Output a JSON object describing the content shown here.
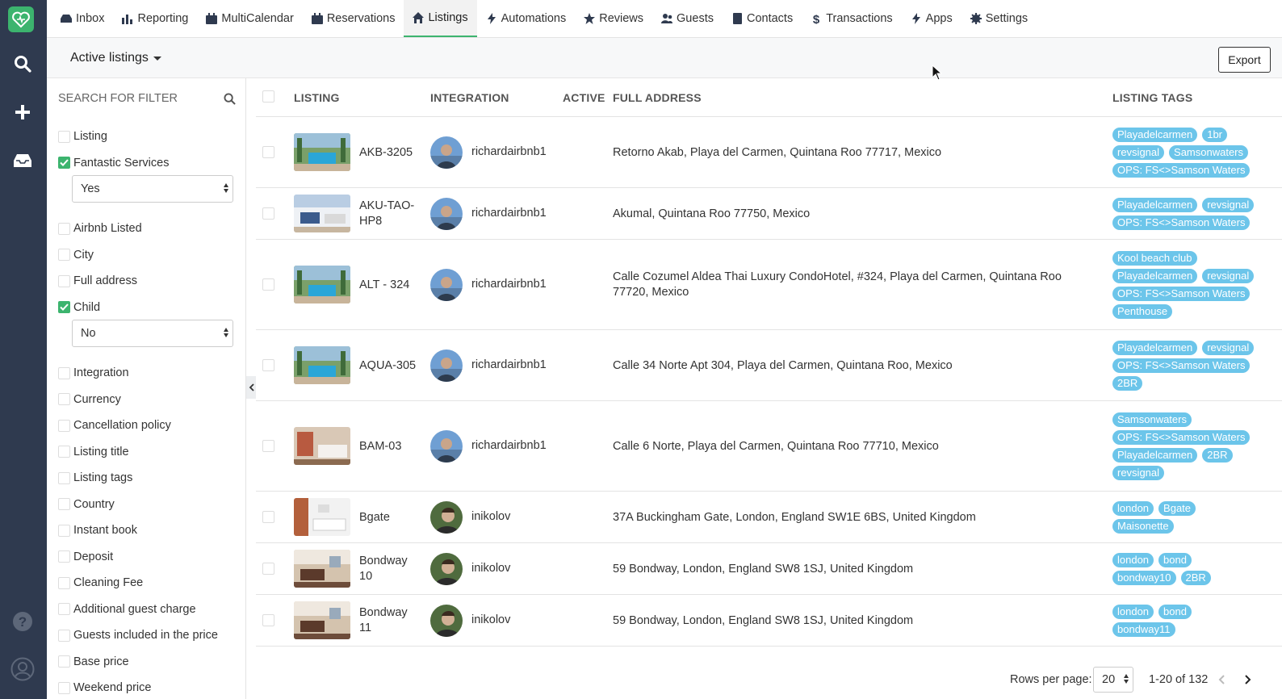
{
  "nav": {
    "items": [
      {
        "label": "Inbox",
        "icon": "inbox-icon"
      },
      {
        "label": "Reporting",
        "icon": "bar-chart-icon"
      },
      {
        "label": "MultiCalendar",
        "icon": "calendar-icon"
      },
      {
        "label": "Reservations",
        "icon": "calendar-check-icon"
      },
      {
        "label": "Listings",
        "icon": "home-icon",
        "active": true
      },
      {
        "label": "Automations",
        "icon": "bolt-icon"
      },
      {
        "label": "Reviews",
        "icon": "star-icon"
      },
      {
        "label": "Guests",
        "icon": "users-icon"
      },
      {
        "label": "Contacts",
        "icon": "address-book-icon"
      },
      {
        "label": "Transactions",
        "icon": "dollar-icon"
      },
      {
        "label": "Apps",
        "icon": "bolt-icon"
      },
      {
        "label": "Settings",
        "icon": "gear-icon"
      }
    ]
  },
  "header": {
    "view_label": "Active listings",
    "export_label": "Export"
  },
  "filters": {
    "search_placeholder": "SEARCH FOR FILTER",
    "items": [
      {
        "label": "Listing",
        "checked": false
      },
      {
        "label": "Fantastic Services",
        "checked": true,
        "select_value": "Yes"
      },
      {
        "label": "Airbnb Listed",
        "checked": false
      },
      {
        "label": "City",
        "checked": false
      },
      {
        "label": "Full address",
        "checked": false
      },
      {
        "label": "Child",
        "checked": true,
        "select_value": "No"
      },
      {
        "label": "Integration",
        "checked": false
      },
      {
        "label": "Currency",
        "checked": false
      },
      {
        "label": "Cancellation policy",
        "checked": false
      },
      {
        "label": "Listing title",
        "checked": false
      },
      {
        "label": "Listing tags",
        "checked": false
      },
      {
        "label": "Country",
        "checked": false
      },
      {
        "label": "Instant book",
        "checked": false
      },
      {
        "label": "Deposit",
        "checked": false
      },
      {
        "label": "Cleaning Fee",
        "checked": false
      },
      {
        "label": "Additional guest charge",
        "checked": false
      },
      {
        "label": "Guests included in the price",
        "checked": false
      },
      {
        "label": "Base price",
        "checked": false
      },
      {
        "label": "Weekend price",
        "checked": false
      }
    ]
  },
  "table": {
    "columns": {
      "listing": "LISTING",
      "integration": "INTEGRATION",
      "active": "ACTIVE",
      "address": "FULL ADDRESS",
      "tags": "LISTING TAGS"
    },
    "rows": [
      {
        "name": "AKB-3205",
        "integration": "richardairbnb1",
        "address": "Retorno Akab, Playa del Carmen, Quintana Roo 77717, Mexico",
        "tags": [
          "Playadelcarmen",
          "1br",
          "revsignal",
          "Samsonwaters",
          "OPS: FS<>Samson Waters"
        ],
        "thumb": "pool"
      },
      {
        "name": "AKU-TAO-HP8",
        "integration": "richardairbnb1",
        "address": "Akumal, Quintana Roo 77750, Mexico",
        "tags": [
          "Playadelcarmen",
          "revsignal",
          "OPS: FS<>Samson Waters"
        ],
        "thumb": "room"
      },
      {
        "name": "ALT - 324",
        "integration": "richardairbnb1",
        "address": "Calle Cozumel Aldea Thai Luxury CondoHotel, #324, Playa del Carmen, Quintana Roo 77720, Mexico",
        "tags": [
          "Kool beach club",
          "Playadelcarmen",
          "revsignal",
          "OPS: FS<>Samson Waters",
          "Penthouse"
        ],
        "thumb": "pool"
      },
      {
        "name": "AQUA-305",
        "integration": "richardairbnb1",
        "address": "Calle 34 Norte Apt 304, Playa del Carmen, Quintana Roo, Mexico",
        "tags": [
          "Playadelcarmen",
          "revsignal",
          "OPS: FS<>Samson Waters",
          "2BR"
        ],
        "thumb": "pool"
      },
      {
        "name": "BAM-03",
        "integration": "richardairbnb1",
        "address": "Calle 6 Norte, Playa del Carmen, Quintana Roo 77710, Mexico",
        "tags": [
          "Samsonwaters",
          "OPS: FS<>Samson Waters",
          "Playadelcarmen",
          "2BR",
          "revsignal"
        ],
        "thumb": "bedroom"
      },
      {
        "name": "Bgate",
        "integration": "inikolov",
        "address": "37A Buckingham Gate, London, England SW1E 6BS, United Kingdom",
        "tags": [
          "london",
          "Bgate",
          "Maisonette"
        ],
        "thumb": "kitchen"
      },
      {
        "name": "Bondway 10",
        "integration": "inikolov",
        "address": "59 Bondway, London, England SW8 1SJ, United Kingdom",
        "tags": [
          "london",
          "bond",
          "bondway10",
          "2BR"
        ],
        "thumb": "living"
      },
      {
        "name": "Bondway 11",
        "integration": "inikolov",
        "address": "59 Bondway, London, England SW8 1SJ, United Kingdom",
        "tags": [
          "london",
          "bond",
          "bondway11"
        ],
        "thumb": "living"
      }
    ]
  },
  "pager": {
    "rows_label": "Rows per page:",
    "rows_value": "20",
    "range": "1-20 of 132"
  },
  "colors": {
    "accent": "#3cb46e",
    "rail": "#2f3a4f",
    "tag": "#6cc5ea"
  }
}
